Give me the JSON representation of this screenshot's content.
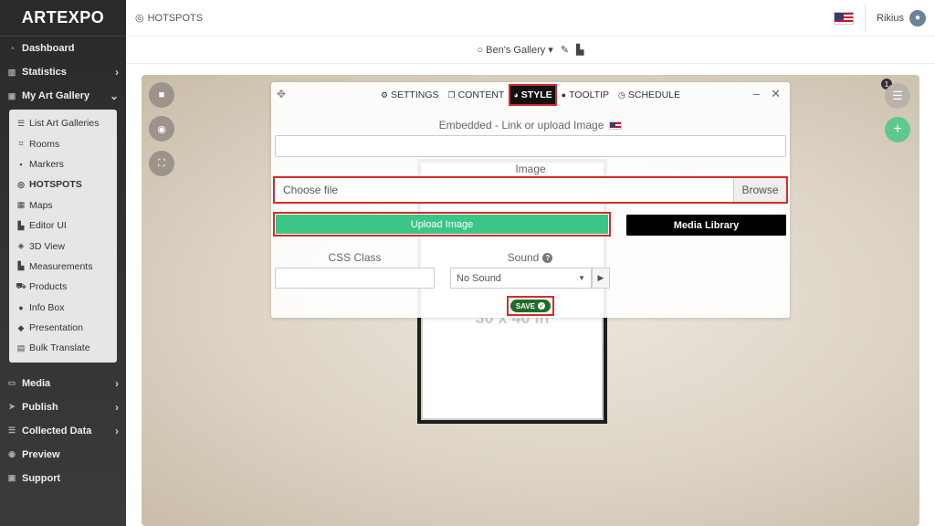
{
  "app": {
    "logo": "ARTEXPO"
  },
  "sidebar": {
    "items_top": [
      {
        "label": "Dashboard",
        "icon": "dashboard-icon"
      },
      {
        "label": "Statistics",
        "icon": "bar-chart-icon",
        "chevron": "›"
      },
      {
        "label": "My Art Gallery",
        "icon": "briefcase-icon",
        "chevron": "⌄"
      }
    ],
    "submenu": [
      {
        "label": "List Art Galleries",
        "icon": "list-icon"
      },
      {
        "label": "Rooms",
        "icon": "rooms-icon"
      },
      {
        "label": "Markers",
        "icon": "marker-icon"
      },
      {
        "label": "HOTSPOTS",
        "icon": "target-icon",
        "active": true
      },
      {
        "label": "Maps",
        "icon": "map-icon"
      },
      {
        "label": "Editor UI",
        "icon": "editor-icon"
      },
      {
        "label": "3D View",
        "icon": "cube-icon"
      },
      {
        "label": "Measurements",
        "icon": "ruler-icon"
      },
      {
        "label": "Products",
        "icon": "cart-icon"
      },
      {
        "label": "Info Box",
        "icon": "info-icon"
      },
      {
        "label": "Presentation",
        "icon": "presentation-icon"
      },
      {
        "label": "Bulk Translate",
        "icon": "translate-icon"
      }
    ],
    "items_bottom": [
      {
        "label": "Media",
        "icon": "monitor-icon",
        "chevron": "›"
      },
      {
        "label": "Publish",
        "icon": "send-icon",
        "chevron": "›"
      },
      {
        "label": "Collected Data",
        "icon": "list-icon",
        "chevron": "›"
      },
      {
        "label": "Preview",
        "icon": "eye-icon"
      },
      {
        "label": "Support",
        "icon": "support-icon"
      }
    ]
  },
  "topbar": {
    "crumb": "HOTSPOTS",
    "user": "Rikius"
  },
  "galbar": {
    "gallery": "Ben's Gallery"
  },
  "modal": {
    "tabs": [
      {
        "label": "SETTINGS",
        "icon": "gear-icon",
        "glyph": "⚙"
      },
      {
        "label": "CONTENT",
        "icon": "copy-icon",
        "glyph": "❐"
      },
      {
        "label": "STYLE",
        "icon": "palette-icon",
        "glyph": "◕",
        "active": true
      },
      {
        "label": "TOOLTIP",
        "icon": "comment-icon",
        "glyph": "●"
      },
      {
        "label": "SCHEDULE",
        "icon": "clock-icon",
        "glyph": "◷"
      }
    ],
    "embed_label": "Embedded - Link or upload Image",
    "image_label": "Image",
    "file_placeholder": "Choose file",
    "browse_label": "Browse",
    "upload_label": "Upload Image",
    "media_library_label": "Media Library",
    "css_class_label": "CSS Class",
    "sound_label": "Sound",
    "sound_value": "No Sound",
    "save_label": "SAVE"
  },
  "canvas": {
    "frame_text": "30 x 40 in",
    "badge_count": "1"
  },
  "colors": {
    "accent_green": "#3cc587",
    "highlight_red": "#d62b2b",
    "save_green": "#1e6d2b"
  }
}
